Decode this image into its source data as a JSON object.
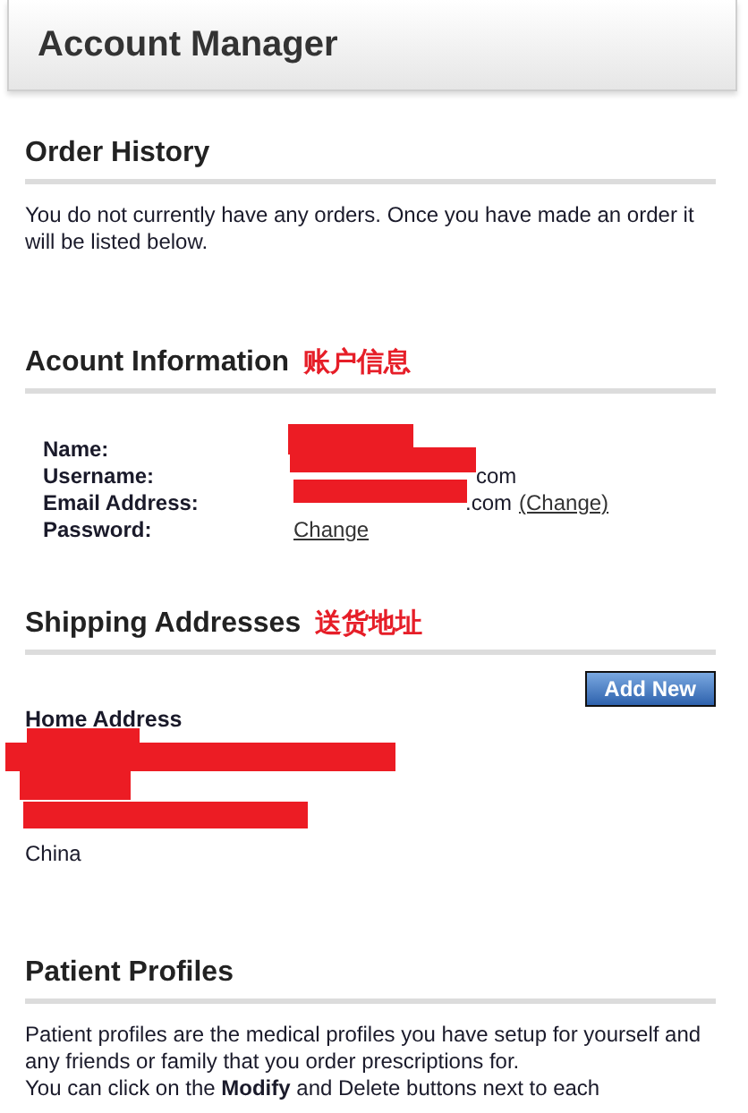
{
  "header": {
    "title": "Account Manager"
  },
  "order_history": {
    "heading": "Order History",
    "text": "You do not currently have any orders. Once you have made an order it will be listed below."
  },
  "account_information": {
    "heading": "Acount Information",
    "annotation": "账户信息",
    "rows": [
      {
        "label": "Name:",
        "value": "",
        "link": ""
      },
      {
        "label": "Username:",
        "value": "com",
        "link": ""
      },
      {
        "label": "Email Address:",
        "value": ".com",
        "link": "(Change)"
      },
      {
        "label": "Password:",
        "value": "",
        "link": "Change"
      }
    ]
  },
  "shipping_addresses": {
    "heading": "Shipping Addresses",
    "annotation": "送货地址",
    "add_button": "Add New",
    "address": {
      "label": "Home Address",
      "country": "China"
    }
  },
  "patient_profiles": {
    "heading": "Patient Profiles",
    "paragraphs": [
      "Patient profiles are the medical profiles you have setup for yourself and any friends or family that you order prescriptions for.",
      "You can click on the **Modify** and Delete buttons next to each"
    ]
  }
}
